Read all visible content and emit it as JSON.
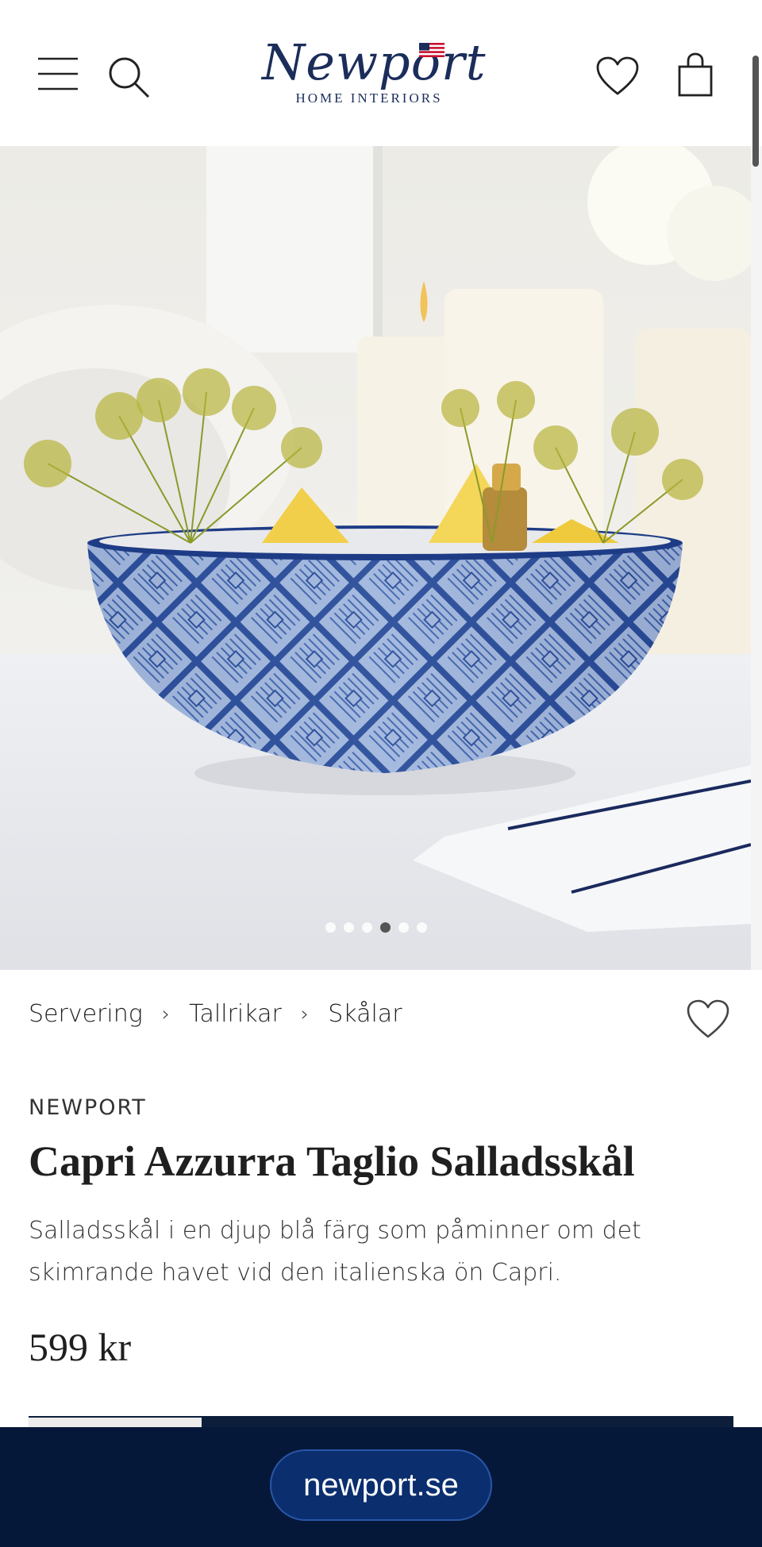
{
  "header": {
    "logo_text": "Newport",
    "logo_subtitle": "HOME INTERIORS",
    "icons": [
      "menu-icon",
      "search-icon",
      "heart-icon",
      "bag-icon"
    ]
  },
  "gallery": {
    "total_images": 6,
    "active_index": 3
  },
  "breadcrumb": [
    "Servering",
    "Tallrikar",
    "Skålar"
  ],
  "breadcrumb_separator": "›",
  "product": {
    "brand": "NEWPORT",
    "title": "Capri Azzurra Taglio Salladsskål",
    "description": "Salladsskål i en djup blå färg som påminner om det skimrande havet vid den italienska ön Capri.",
    "price": "599 kr"
  },
  "footer": {
    "url": "newport.se"
  },
  "colors": {
    "brand_navy": "#1b2d5a",
    "footer_bg": "#06183a",
    "pill_bg": "#0a2e6e"
  }
}
